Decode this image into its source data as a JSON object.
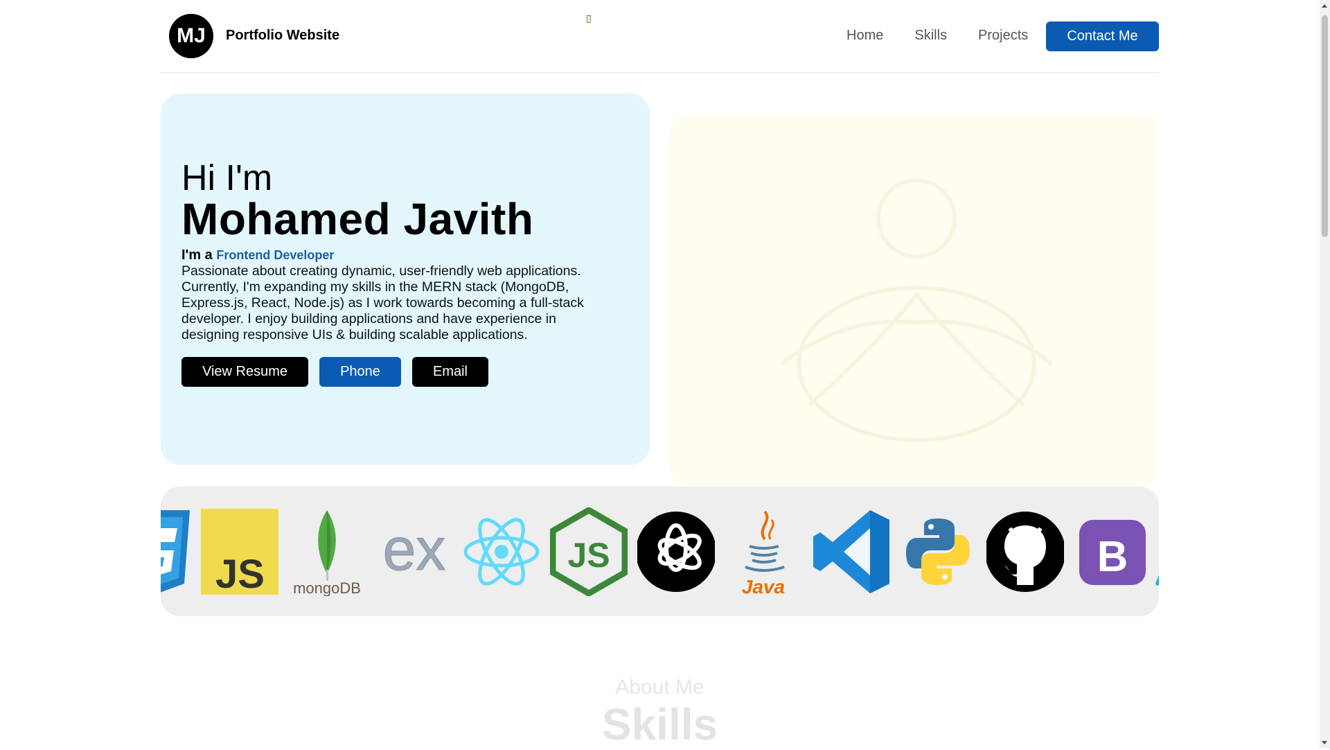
{
  "header": {
    "logo_initials": "MJ",
    "site_title": "Portfolio Website",
    "nav": [
      "Home",
      "Skills",
      "Projects"
    ],
    "contact_label": "Contact Me",
    "small_icon": "▯"
  },
  "hero": {
    "greeting": "Hi I'm",
    "name": "Mohamed Javith",
    "role_prefix": "I'm a ",
    "role_title": "Frontend Developer",
    "description": "Passionate about creating dynamic, user-friendly web applications. Currently, I'm expanding my skills in the MERN stack (MongoDB, Express.js, React, Node.js) as I work towards becoming a full-stack developer. I enjoy building applications and have experience in designing responsive UIs & building scalable applications.",
    "buttons": {
      "resume": "View Resume",
      "phone": "Phone",
      "email": "Email"
    },
    "accent_color": "#0c5bb3",
    "accent_text_color": "#1a5fa8"
  },
  "skills_strip": {
    "icons": [
      "css3-icon",
      "javascript-icon",
      "mongodb-icon",
      "express-icon",
      "react-icon",
      "nodejs-icon",
      "openai-icon",
      "java-icon",
      "vscode-icon",
      "python-icon",
      "github-icon",
      "bootstrap-icon"
    ],
    "js_text": "JS",
    "mongodb_text": "mongoDB",
    "express_text": "ex",
    "java_text": "Java",
    "bootstrap_text": "B"
  },
  "about": {
    "subtitle": "About Me",
    "title": "Skills"
  }
}
